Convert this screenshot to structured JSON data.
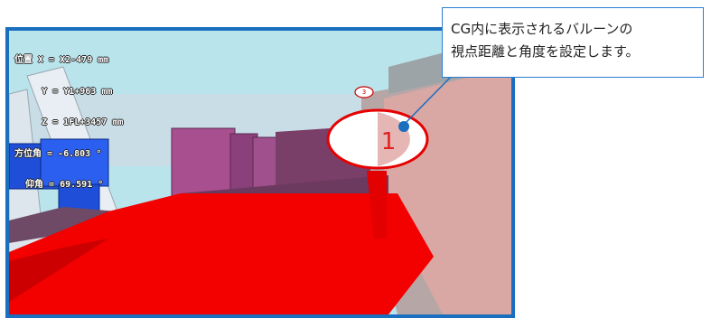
{
  "viewport": {
    "readout": [
      "位置 X = X2-479 mm",
      "     Y = Y1+963 mm",
      "     Z = 1FL+3457 mm",
      "方位角 = -6.803 °",
      "  仰角 = 69.591 °"
    ],
    "balloon_number": "1",
    "small_balloon_label": "3"
  },
  "callout": {
    "line1": "CG内に表示されるバルーンの",
    "line2": "視点距離と角度を設定します。"
  },
  "colors": {
    "frame_border": "#1a6fbf",
    "callout_border": "#2a7fd4",
    "balloon_red": "#e60000",
    "sky": "#b9e4ec",
    "leader_dot": "#1a6fbf"
  }
}
